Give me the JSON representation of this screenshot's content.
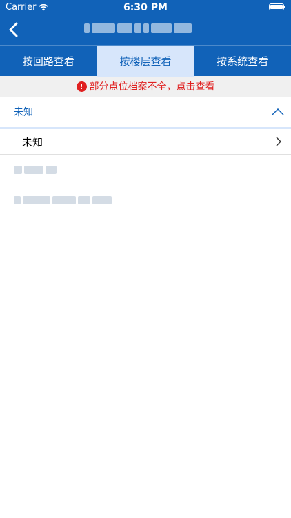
{
  "status_bar": {
    "carrier": "Carrier",
    "time": "6:30 PM"
  },
  "nav": {
    "back_icon": "chevron-left-icon"
  },
  "tabs": [
    {
      "label": "按回路查看",
      "active": false
    },
    {
      "label": "按楼层查看",
      "active": true
    },
    {
      "label": "按系统查看",
      "active": false
    }
  ],
  "warning": {
    "text": "部分点位档案不全，点击查看",
    "color": "#e02020"
  },
  "group": {
    "label": "未知",
    "icon": "chevron-up-icon"
  },
  "list": [
    {
      "label": "未知",
      "icon": "chevron-right-icon"
    }
  ],
  "colors": {
    "primary": "#1162b8",
    "active_tab_bg": "#d7e6fb"
  }
}
